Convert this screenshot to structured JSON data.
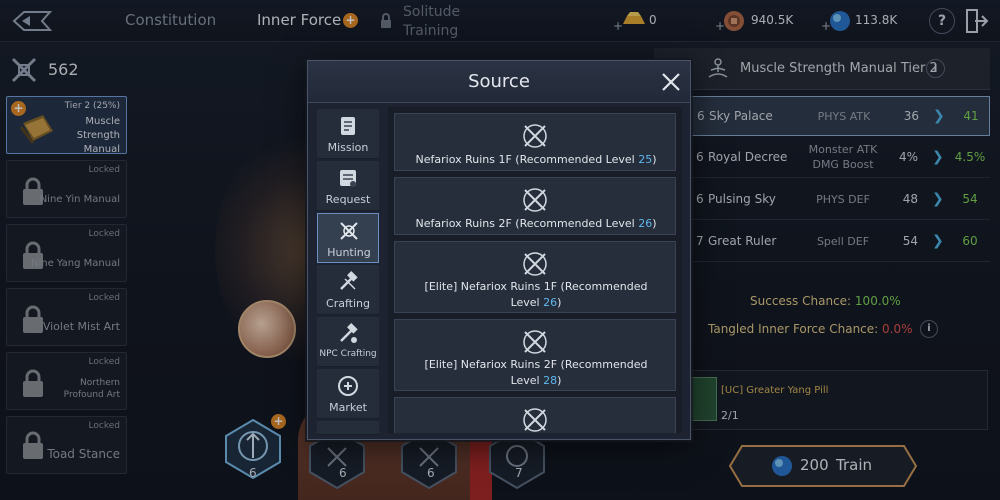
{
  "topbar": {
    "tabs": [
      {
        "label": "Constitution"
      },
      {
        "label": "Inner Force",
        "badge": "+"
      },
      {
        "label": "Solitude Training",
        "locked": true
      }
    ],
    "resources": [
      {
        "icon": "gold-ingot-icon",
        "value": "0"
      },
      {
        "icon": "copper-coin-icon",
        "value": "940.5K"
      },
      {
        "icon": "blue-orb-icon",
        "value": "113.8K"
      }
    ],
    "help_label": "?",
    "plus": "+"
  },
  "left": {
    "count": "562",
    "manuals": [
      {
        "status": "Tier 2 (25%)",
        "name": "Muscle Strength Manual",
        "selected": true
      },
      {
        "status": "Locked",
        "name": "Nine Yin Manual"
      },
      {
        "status": "Locked",
        "name": "Nine Yang Manual"
      },
      {
        "status": "Locked",
        "name": "Violet Mist Art"
      },
      {
        "status": "Locked",
        "name": "Northern Profound Art"
      },
      {
        "status": "Locked",
        "name": "Toad Stance"
      }
    ]
  },
  "nodes": [
    {
      "num": "6",
      "badge": "+"
    },
    {
      "num": "6"
    },
    {
      "num": "6"
    },
    {
      "num": "7"
    }
  ],
  "right": {
    "title": "Muscle Strength Manual Tier 2",
    "info_label": "i",
    "stats": [
      {
        "level": "6",
        "name": "Sky Palace",
        "type": "PHYS ATK",
        "current": "36",
        "next": "41",
        "selected": true
      },
      {
        "level": "6",
        "name": "Royal Decree",
        "type": "Monster ATK DMG Boost",
        "current": "4%",
        "next": "4.5%"
      },
      {
        "level": "6",
        "name": "Pulsing Sky",
        "type": "PHYS DEF",
        "current": "48",
        "next": "54"
      },
      {
        "level": "7",
        "name": "Great Ruler",
        "type": "Spell DEF",
        "current": "54",
        "next": "60"
      }
    ],
    "success_label": "Success Chance:",
    "success_value": "100.0%",
    "tangled_label": "Tangled Inner Force Chance:",
    "tangled_value": "0.0%",
    "material_name": "[UC] Greater Yang Pill",
    "material_count": "2/1",
    "train_cost": "200",
    "train_label": "Train"
  },
  "modal": {
    "title": "Source",
    "tabs": [
      {
        "label": "Mission",
        "icon": "scroll-icon"
      },
      {
        "label": "Request",
        "icon": "request-scroll-icon"
      },
      {
        "label": "Hunting",
        "icon": "crossed-swords-icon",
        "active": true
      },
      {
        "label": "Crafting",
        "icon": "hammer-icon"
      },
      {
        "label": "NPC Crafting",
        "icon": "npc-hammer-icon"
      },
      {
        "label": "Market",
        "icon": "market-icon"
      }
    ],
    "sources": [
      {
        "text": "Nefariox Ruins 1F (Recommended Level ",
        "level": "25",
        "suffix": ")"
      },
      {
        "text": "Nefariox Ruins 2F (Recommended Level ",
        "level": "26",
        "suffix": ")"
      },
      {
        "text": "[Elite] Nefariox Ruins 1F (Recommended Level ",
        "level": "26",
        "suffix": ")"
      },
      {
        "text": "[Elite] Nefariox Ruins 2F (Recommended Level ",
        "level": "28",
        "suffix": ")"
      }
    ]
  },
  "colors": {
    "accent_blue": "#5eb8ee",
    "next_green": "#7fd35a",
    "warning_red": "#e0554f",
    "badge_orange": "#e08a2a",
    "train_border": "#c9955a"
  }
}
